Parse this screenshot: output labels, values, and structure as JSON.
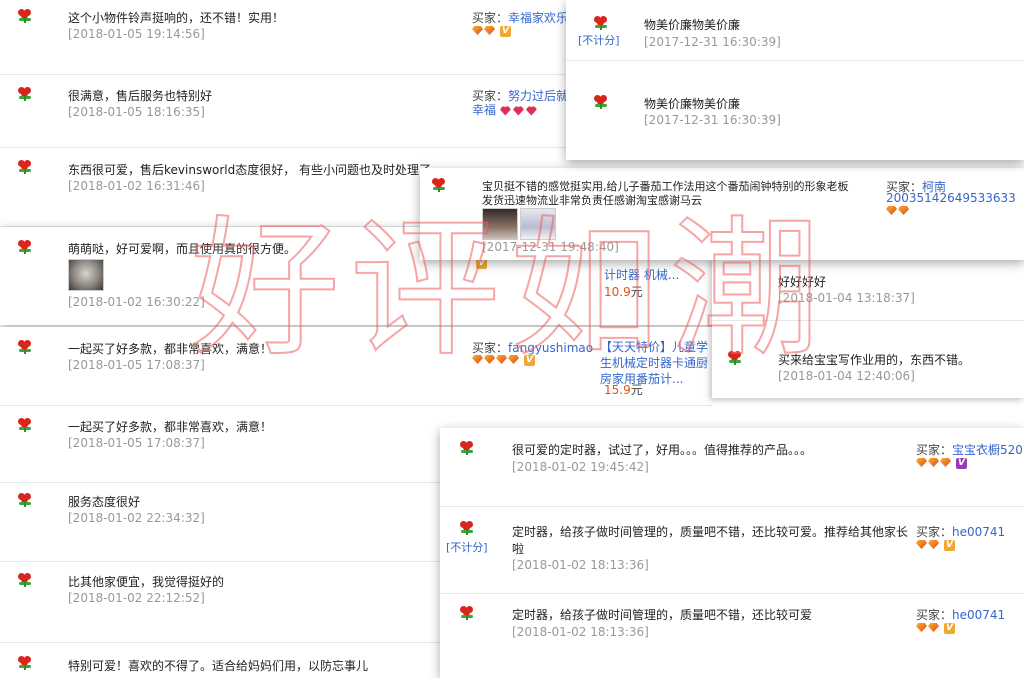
{
  "watermark": "好评如潮",
  "colors": {
    "accent_link": "#3366cc",
    "price": "#e4520e",
    "watermark": "#ee5a5a"
  },
  "left_panel": {
    "reviews": [
      {
        "text": "这个小物件铃声挺响的，还不错！实用！",
        "date": "[2018-01-05 19:14:56]"
      },
      {
        "text": "很满意，售后服务也特别好",
        "date": "[2018-01-05 18:16:35]"
      },
      {
        "text": "东西很可爱，售后kevinsworld态度很好， 有些小问题也及时处理了。",
        "date": "[2018-01-02 16:31:46]"
      },
      {
        "text": "萌萌哒，好可爱啊，而且使用真的很方便。",
        "date": "[2018-01-02 16:30:22]"
      },
      {
        "text": "一起买了好多款，都非常喜欢，满意！",
        "date": "[2018-01-05 17:08:37]"
      },
      {
        "text": "一起买了好多款，都非常喜欢，满意！",
        "date": "[2018-01-05 17:08:37]"
      },
      {
        "text": "服务态度很好",
        "date": "[2018-01-02 22:34:32]"
      },
      {
        "text": "比其他家便宜，我觉得挺好的",
        "date": "[2018-01-02 22:12:52]"
      },
      {
        "text": "特别可爱！喜欢的不得了。适合给妈妈们用，以防忘事儿",
        "date": ""
      }
    ],
    "buyers": [
      {
        "label": "买家：",
        "name": "幸福家欢乐",
        "line2": ""
      },
      {
        "label": "买家：",
        "name": "努力过后就",
        "line2": "幸福"
      },
      {
        "label": "买家：",
        "name": "fangyushimao",
        "line2": ""
      }
    ],
    "product": {
      "promo": "【天天特价】儿童学生机械定时器卡通厨房家用番茄计...",
      "price": "15.9",
      "unit": "元"
    },
    "product_partial": {
      "text": "计时器 机械...",
      "price": "10.9",
      "unit": "元"
    }
  },
  "top_right_panel": {
    "not_counted": "[不计分]",
    "reviews": [
      {
        "text": "物美价廉物美价廉",
        "date": "[2017-12-31 16:30:39]"
      },
      {
        "text": "物美价廉物美价廉",
        "date": "[2017-12-31 16:30:39]"
      }
    ]
  },
  "middle_panel": {
    "text_line1": "宝贝挺不错的感觉挺实用,给儿子番茄工作法用这个番茄闹钟特别的形象老板",
    "text_line2": "发货迅速物流业非常负责任感谢淘宝感谢马云",
    "date": "[2017-12-31 19:48:40]",
    "buyer_label": "买家：",
    "buyer_name": "柯南",
    "buyer_id": "20035142649533633"
  },
  "right_mid_panel": {
    "reviews": [
      {
        "text": "好好好好",
        "date": "[2018-01-04 13:18:37]"
      },
      {
        "text": "买来给宝宝写作业用的，东西不错。",
        "date": "[2018-01-04 12:40:06]"
      }
    ]
  },
  "bottom_right_panel": {
    "not_counted": "[不计分]",
    "reviews": [
      {
        "text": "很可爱的定时器，试过了，好用。。。值得推荐的产品。。。",
        "date": "[2018-01-02 19:45:42]",
        "buyer_label": "买家：",
        "buyer_name": "宝宝衣橱520"
      },
      {
        "text": "定时器，给孩子做时间管理的，质量吧不错，还比较可爱。推荐给其他家长",
        "text2": "啦",
        "date": "[2018-01-02 18:13:36]",
        "buyer_label": "买家：",
        "buyer_name": "he00741"
      },
      {
        "text": "定时器，给孩子做时间管理的，质量吧不错，还比较可爱",
        "date": "[2018-01-02 18:13:36]",
        "buyer_label": "买家：",
        "buyer_name": "he00741"
      }
    ]
  }
}
